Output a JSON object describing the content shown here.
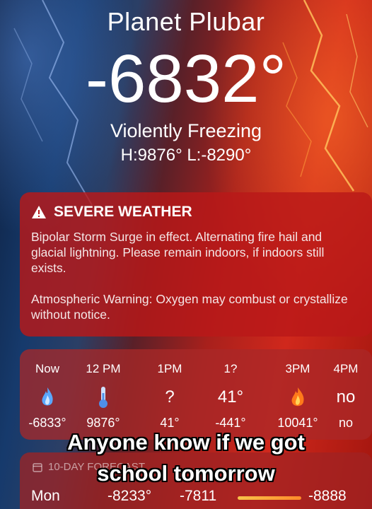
{
  "location": {
    "name": "Planet Plubar"
  },
  "current": {
    "temperature": "-6832°",
    "condition": "Violently Freezing",
    "high_low": "H:9876°  L:-8290°"
  },
  "alert": {
    "title": "SEVERE WEATHER",
    "icon": "warning-triangle-icon",
    "paragraph1": "Bipolar Storm Surge in effect. Alternating fire hail and glacial lightning. Please remain indoors, if indoors still exists.",
    "paragraph2": "Atmospheric Warning: Oxygen may combust or crystallize without notice."
  },
  "hourly": [
    {
      "time": "Now",
      "icon": "blue-flame-icon",
      "value": "-6833°"
    },
    {
      "time": "12 PM",
      "icon": "thermometer-icon",
      "value": "9876°"
    },
    {
      "time": "1PM",
      "icon_text": "?",
      "value": "41°"
    },
    {
      "time": "1?",
      "icon_text": "41°",
      "value": "-441°"
    },
    {
      "time": "3PM",
      "icon": "orange-flame-icon",
      "value": "10041°"
    },
    {
      "time": "4PM",
      "icon_text": "no",
      "value": "no"
    }
  ],
  "daily": {
    "header": "10-DAY FORECAST",
    "rows": [
      {
        "day": "Mon",
        "low": "-8233°",
        "mid": "-7811",
        "high": "-8888"
      }
    ]
  },
  "caption": {
    "line1": "Anyone know if we got",
    "line2": "school tomorrow"
  },
  "colors": {
    "cold": "#1c3f78",
    "hot": "#d1281c",
    "card": "#b91919"
  }
}
